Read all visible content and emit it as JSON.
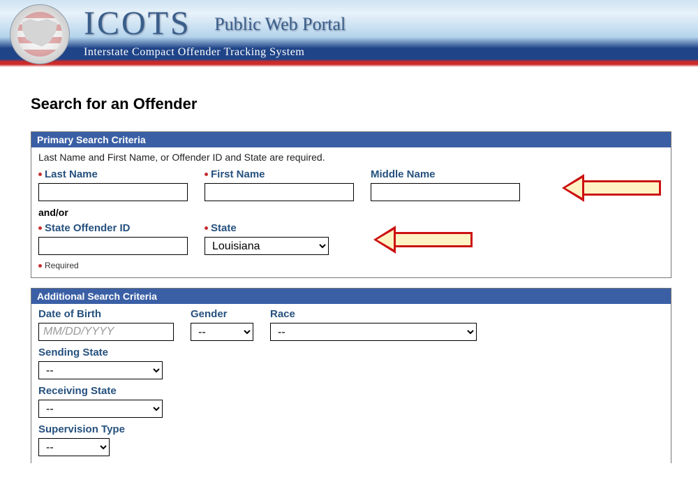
{
  "banner": {
    "acronym": "ICOTS",
    "subtitle": "Public Web Portal",
    "tagline": "Interstate Compact Offender Tracking System"
  },
  "page_title": "Search for an Offender",
  "primary": {
    "heading": "Primary Search Criteria",
    "helper": "Last Name and First Name, or Offender ID and State are required.",
    "last_name_label": "Last Name",
    "first_name_label": "First Name",
    "middle_name_label": "Middle Name",
    "andor": "and/or",
    "offender_id_label": "State Offender ID",
    "state_label": "State",
    "state_value": "Louisiana",
    "required_note": "Required"
  },
  "additional": {
    "heading": "Additional Search Criteria",
    "dob_label": "Date of Birth",
    "dob_placeholder": "MM/DD/YYYY",
    "gender_label": "Gender",
    "gender_value": "--",
    "race_label": "Race",
    "race_value": "--",
    "sending_label": "Sending State",
    "sending_value": "--",
    "receiving_label": "Receiving State",
    "receiving_value": "--",
    "supervision_label": "Supervision Type",
    "supervision_value": "--"
  }
}
